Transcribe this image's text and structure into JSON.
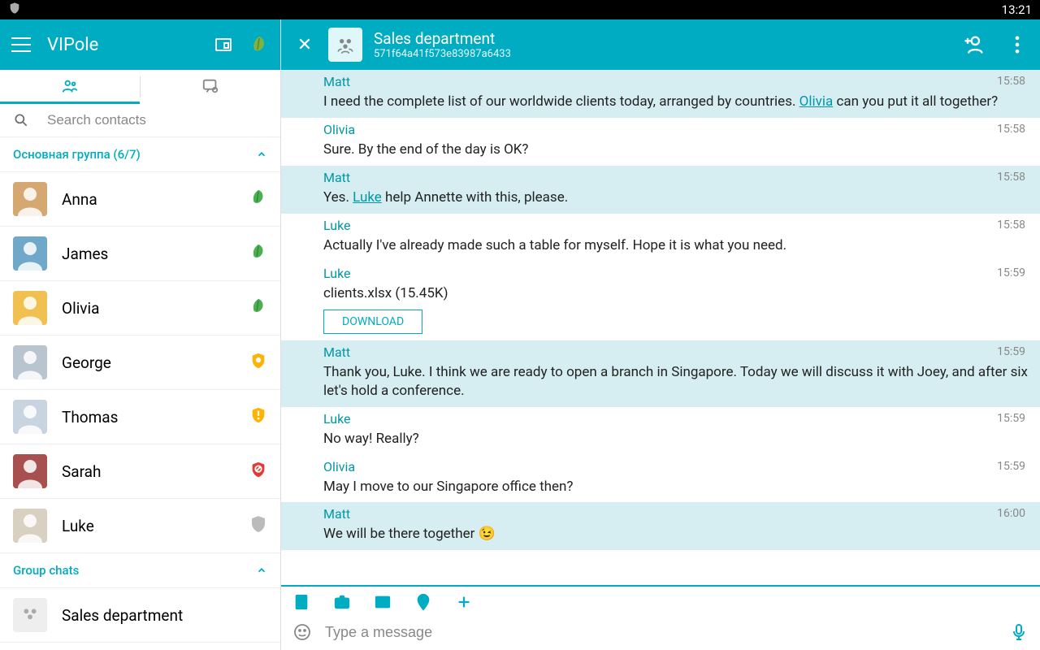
{
  "status_bar": {
    "time": "13:21"
  },
  "sidebar": {
    "title": "VIPole",
    "search_placeholder": "Search contacts",
    "main_group_label": "Основная группа (6/7)",
    "contacts": [
      {
        "name": "Anna",
        "status": "leaf",
        "bg": "#d4a870"
      },
      {
        "name": "James",
        "status": "leaf",
        "bg": "#6fa8c8"
      },
      {
        "name": "Olivia",
        "status": "leaf",
        "bg": "#f0c050"
      },
      {
        "name": "George",
        "status": "shield-o",
        "bg": "#b8c4d0"
      },
      {
        "name": "Thomas",
        "status": "shield-w",
        "bg": "#c8d4e0"
      },
      {
        "name": "Sarah",
        "status": "shield-r",
        "bg": "#a85050"
      },
      {
        "name": "Luke",
        "status": "shield-g",
        "bg": "#d8d0c0"
      }
    ],
    "group_chats_label": "Group chats",
    "group_chats": [
      {
        "name": "Sales department"
      }
    ]
  },
  "chat": {
    "title": "Sales department",
    "subtitle": "571f64a41f573e83987a6433",
    "messages": [
      {
        "sender": "Matt",
        "time": "15:58",
        "alt": true,
        "parts": [
          {
            "t": "I need the complete list of our worldwide clients today, arranged by countries.  "
          },
          {
            "m": "Olivia"
          },
          {
            "t": " can you put it all together?"
          }
        ]
      },
      {
        "sender": "Olivia",
        "time": "15:58",
        "alt": false,
        "parts": [
          {
            "t": "Sure. By the end of the day is OK?"
          }
        ]
      },
      {
        "sender": "Matt",
        "time": "15:58",
        "alt": true,
        "parts": [
          {
            "t": "Yes.  "
          },
          {
            "m": "Luke"
          },
          {
            "t": " help Annette with this, please."
          }
        ]
      },
      {
        "sender": "Luke",
        "time": "15:58",
        "alt": false,
        "parts": [
          {
            "t": "Actually I've already made such a table for myself. Hope it is what you need."
          }
        ]
      },
      {
        "sender": "Luke",
        "time": "15:59",
        "alt": false,
        "file": "clients.xlsx (15.45K)",
        "download": "DOWNLOAD"
      },
      {
        "sender": "Matt",
        "time": "15:59",
        "alt": true,
        "parts": [
          {
            "t": "Thank you, Luke. I think we are ready to open a branch in Singapore. Today we will discuss it with Joey, and after six let's hold a conference."
          }
        ]
      },
      {
        "sender": "Luke",
        "time": "15:59",
        "alt": false,
        "parts": [
          {
            "t": "No way! Really?"
          }
        ]
      },
      {
        "sender": "Olivia",
        "time": "15:59",
        "alt": false,
        "parts": [
          {
            "t": "May I move to our Singapore office then?"
          }
        ]
      },
      {
        "sender": "Matt",
        "time": "16:00",
        "alt": true,
        "parts": [
          {
            "t": "We will be there together 😉"
          }
        ]
      }
    ],
    "compose_placeholder": "Type a message"
  }
}
